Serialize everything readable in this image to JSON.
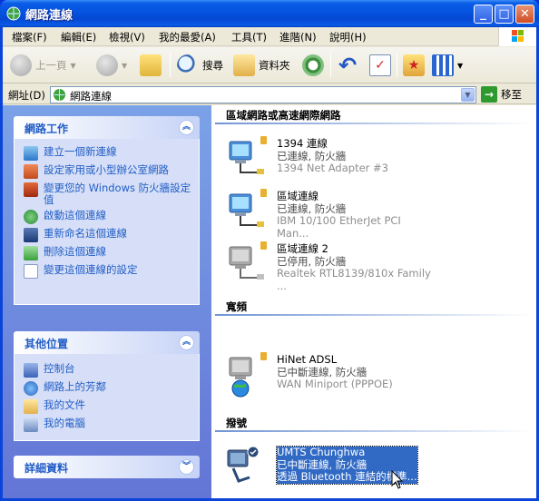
{
  "window": {
    "title": "網路連線",
    "minimize": "_",
    "maximize": "□",
    "close": "✕"
  },
  "menu": [
    "檔案(F)",
    "編輯(E)",
    "檢視(V)",
    "我的最愛(A)",
    "工具(T)",
    "進階(N)",
    "說明(H)"
  ],
  "toolbar": {
    "back": "上一頁",
    "search": "搜尋",
    "folders": "資料夾"
  },
  "address": {
    "label": "網址(D)",
    "value": "網路連線",
    "go": "移至"
  },
  "left": {
    "network_tasks": {
      "title": "網路工作",
      "items": [
        "建立一個新連線",
        "設定家用或小型辦公室網路",
        "變更您的 Windows 防火牆設定值",
        "啟動這個連線",
        "重新命名這個連線",
        "刪除這個連線",
        "變更這個連線的設定"
      ]
    },
    "other_places": {
      "title": "其他位置",
      "items": [
        "控制台",
        "網路上的芳鄰",
        "我的文件",
        "我的電腦"
      ]
    },
    "details": {
      "title": "詳細資料"
    }
  },
  "right": {
    "groups": [
      {
        "title": "區域網路或高速網際網路",
        "connections": [
          {
            "name": "1394 連線",
            "status": "已連線, 防火牆",
            "device": "1394 Net Adapter #3"
          },
          {
            "name": "區域連線",
            "status": "已連線, 防火牆",
            "device": "IBM 10/100 EtherJet PCI Man..."
          },
          {
            "name": "區域連線 2",
            "status": "已停用, 防火牆",
            "device": "Realtek RTL8139/810x Family ..."
          }
        ]
      },
      {
        "title": "寬頻",
        "connections": [
          {
            "name": "HiNet ADSL",
            "status": "已中斷連線, 防火牆",
            "device": "WAN Miniport (PPPOE)"
          }
        ]
      },
      {
        "title": "撥號",
        "connections": [
          {
            "name": "UMTS Chunghwa",
            "status": "已中斷連線, 防火牆",
            "device": "透過 Bluetooth 連結的標準..."
          }
        ]
      }
    ]
  },
  "colors": {
    "title_bar": "#0553e0",
    "task_link": "#215dc6",
    "selection": "#316ac5"
  }
}
